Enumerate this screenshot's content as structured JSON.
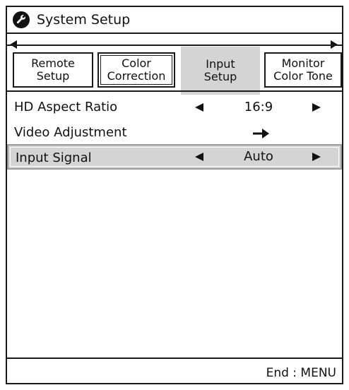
{
  "window": {
    "title": "System Setup",
    "icon": "wrench-icon"
  },
  "tabs": [
    {
      "label": "Remote\nSetup",
      "state": "normal"
    },
    {
      "label": "Color\nCorrection",
      "state": "outlined"
    },
    {
      "label": "Input\nSetup",
      "state": "active"
    },
    {
      "label": "Monitor\nColor Tone",
      "state": "normal"
    }
  ],
  "menu": {
    "hd_aspect": {
      "label": "HD Aspect Ratio",
      "value": "16:9"
    },
    "video_adjustment": {
      "label": "Video Adjustment",
      "action_icon": "right-arrow-icon"
    },
    "input_signal": {
      "label": "Input Signal",
      "value": "Auto",
      "selected": true
    }
  },
  "footer": {
    "hint": "End : MENU"
  },
  "colors": {
    "border": "#1a1a1a",
    "highlight": "#d4d4d4",
    "background": "#ffffff"
  }
}
